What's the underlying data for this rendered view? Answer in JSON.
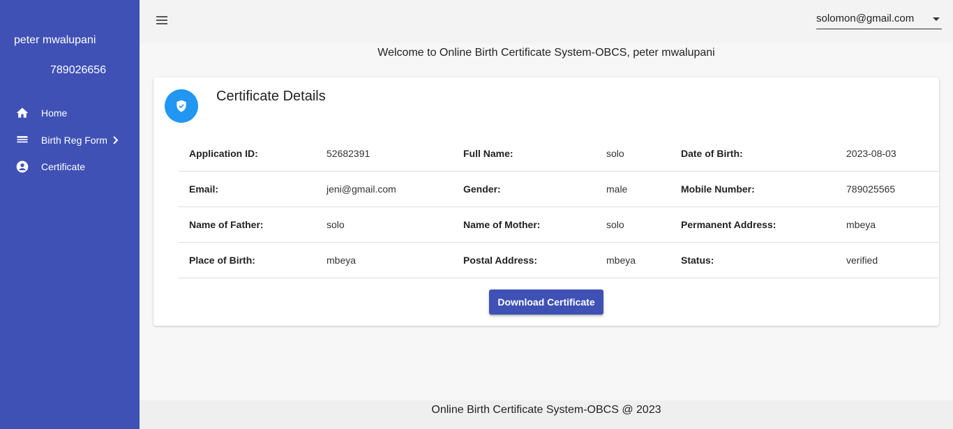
{
  "sidebar": {
    "user_name": "peter mwalupani",
    "user_phone": "789026656",
    "items": [
      {
        "label": "Home",
        "icon": "home-icon"
      },
      {
        "label": "Birth Reg Form",
        "icon": "form-icon"
      },
      {
        "label": "Certificate",
        "icon": "account-circle-icon"
      }
    ]
  },
  "topbar": {
    "user_email": "solomon@gmail.com"
  },
  "welcome": "Welcome to Online Birth Certificate System-OBCS, peter mwalupani",
  "card": {
    "title": "Certificate Details",
    "rows": [
      [
        {
          "label": "Application ID:",
          "value": "52682391"
        },
        {
          "label": "Full Name:",
          "value": "solo"
        },
        {
          "label": "Date of Birth:",
          "value": "2023-08-03"
        }
      ],
      [
        {
          "label": "Email:",
          "value": "jeni@gmail.com"
        },
        {
          "label": "Gender:",
          "value": "male"
        },
        {
          "label": "Mobile Number:",
          "value": "789025565"
        }
      ],
      [
        {
          "label": "Name of Father:",
          "value": "solo"
        },
        {
          "label": "Name of Mother:",
          "value": "solo"
        },
        {
          "label": "Permanent Address:",
          "value": "mbeya"
        }
      ],
      [
        {
          "label": "Place of Birth:",
          "value": "mbeya"
        },
        {
          "label": "Postal Address:",
          "value": "mbeya"
        },
        {
          "label": "Status:",
          "value": "verified"
        }
      ]
    ],
    "download_label": "Download Certificate"
  },
  "footer": "Online Birth Certificate System-OBCS @ 2023",
  "colors": {
    "sidebar": "#3f51b5",
    "accent_blue": "#2196f3",
    "button": "#3f51b5"
  }
}
